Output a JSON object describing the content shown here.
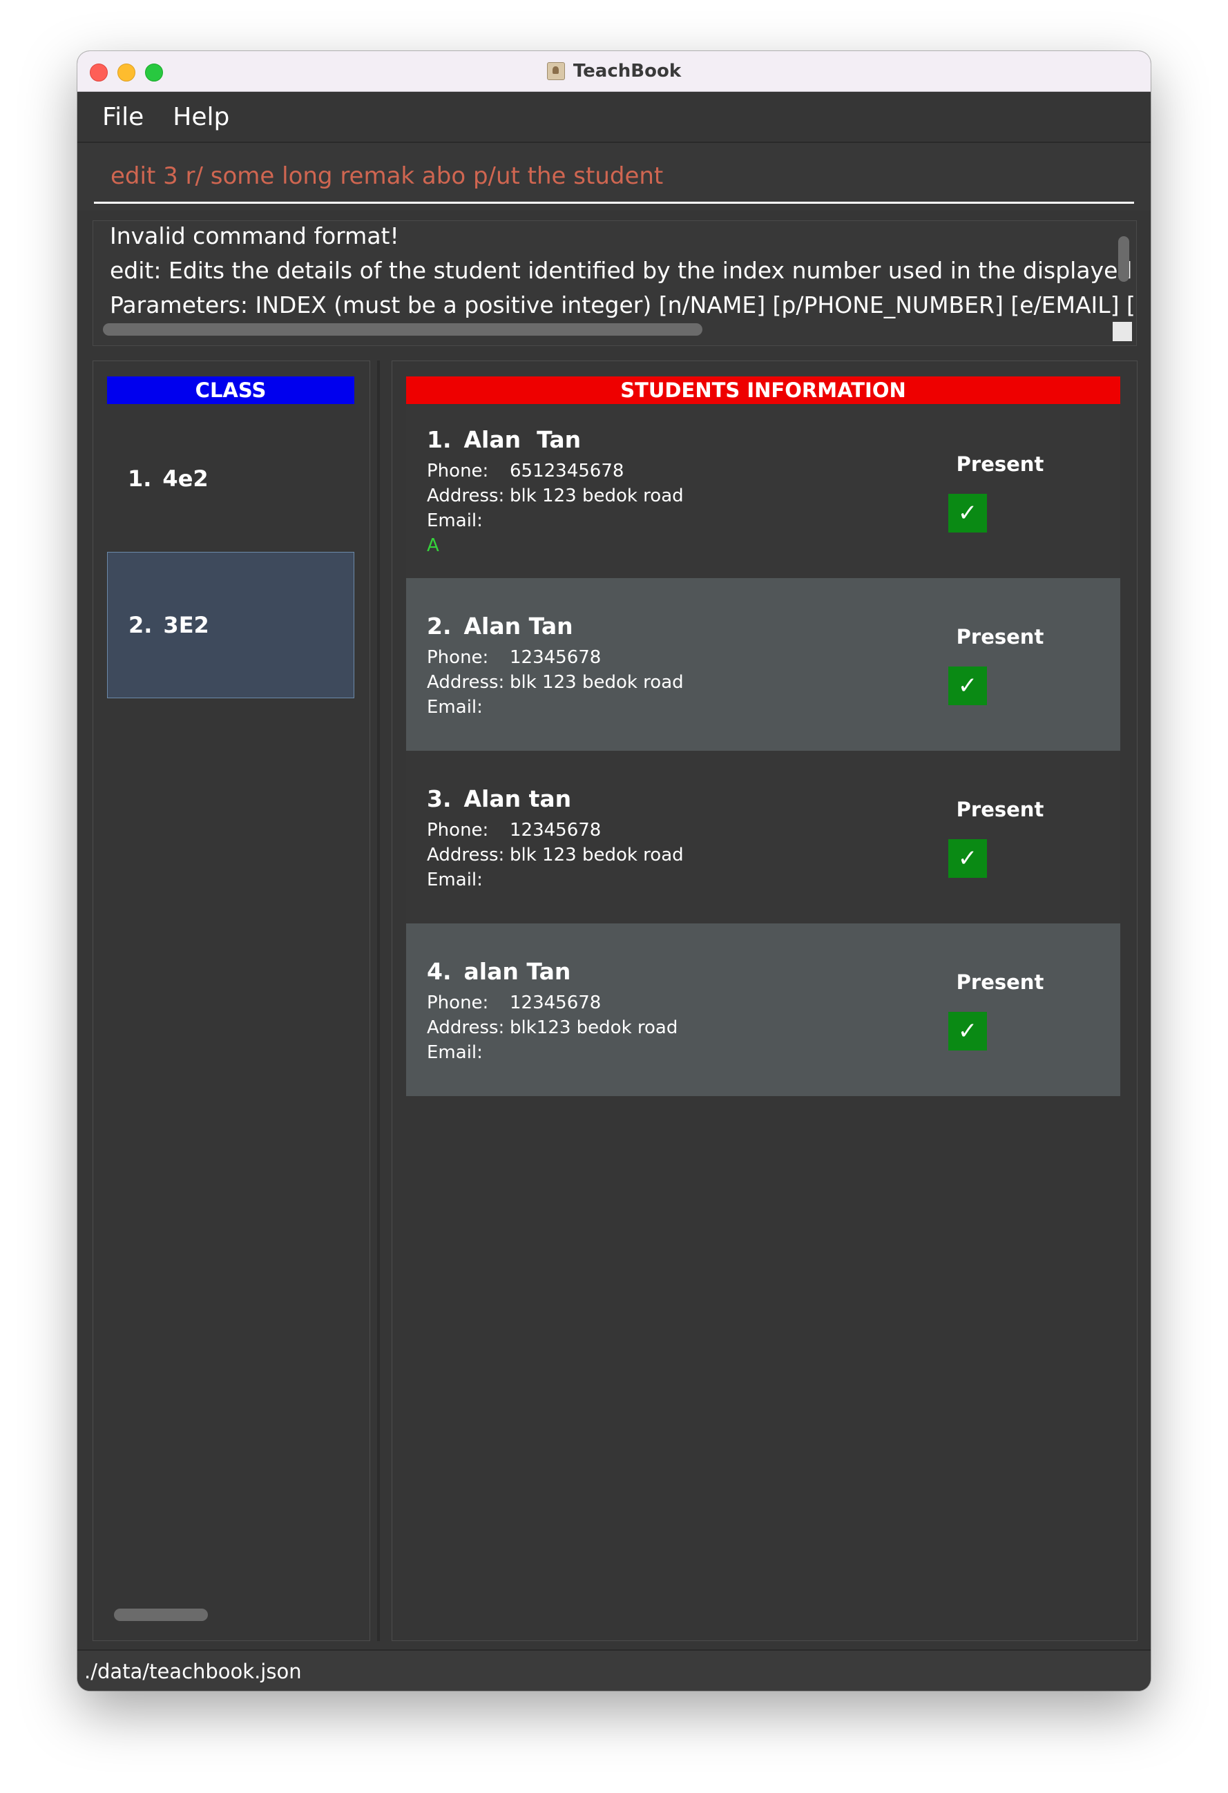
{
  "window": {
    "title": "TeachBook"
  },
  "menu": {
    "file": "File",
    "help": "Help"
  },
  "command": {
    "value": "edit 3 r/ some long remak abo p/ut the student"
  },
  "result": {
    "lines": [
      "Invalid command format!",
      "edit: Edits the details of the student identified by the index number used in the displayed stuc",
      "Parameters: INDEX (must be a positive integer) [n/NAME] [p/PHONE_NUMBER] [e/EMAIL] [a/A"
    ]
  },
  "classes": {
    "header": "CLASS",
    "items": [
      {
        "index": "1.",
        "name": "4e2",
        "selected": false
      },
      {
        "index": "2.",
        "name": "3E2",
        "selected": true
      }
    ]
  },
  "students": {
    "header": "STUDENTS INFORMATION",
    "phone_label": "Phone:",
    "address_label": "Address:",
    "email_label": "Email:",
    "present_label": "Present",
    "check_glyph": "✓",
    "items": [
      {
        "index": "1.",
        "name": "Alan  Tan",
        "phone": "6512345678",
        "address": "blk 123 bedok road",
        "email": "",
        "remark": "A",
        "present": true
      },
      {
        "index": "2.",
        "name": "Alan Tan",
        "phone": "12345678",
        "address": "blk 123 bedok road",
        "email": "",
        "remark": "",
        "present": true
      },
      {
        "index": "3.",
        "name": "Alan tan",
        "phone": "12345678",
        "address": "blk 123 bedok road",
        "email": "",
        "remark": "",
        "present": true
      },
      {
        "index": "4.",
        "name": "alan Tan",
        "phone": "12345678",
        "address": "blk123 bedok road",
        "email": "",
        "remark": "",
        "present": true
      }
    ]
  },
  "status": {
    "path": "./data/teachbook.json"
  },
  "colors": {
    "class_header": "#0000ee",
    "students_header": "#ee0000",
    "command_text": "#d06651",
    "remark": "#35d23b",
    "checkbox": "#0a8a14",
    "selected_class": "#3e4a5c"
  }
}
